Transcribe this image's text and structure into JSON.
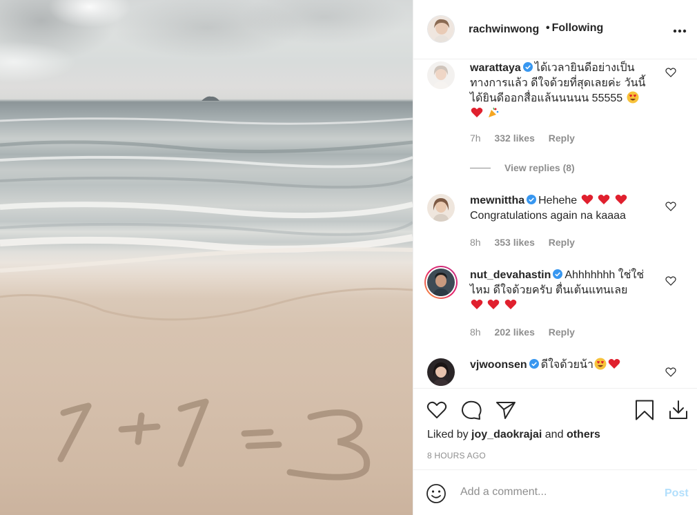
{
  "header": {
    "username": "rachwinwong",
    "follow_label": "Following",
    "more_icon": "more-horizontal-icon"
  },
  "comments": [
    {
      "username": "warattaya",
      "verified": true,
      "text": "ได้เวลายินดีอย่างเป็นทางการแล้ว ดีใจด้วยที่สุดเลยค่ะ วันนี้ได้ยินดีออกสื่อแล้นนนนน 55555",
      "emojis": [
        "heart-eyes-emoji",
        "red-heart-emoji",
        "party-popper-emoji"
      ],
      "time": "7h",
      "likes": "332 likes",
      "reply_label": "Reply",
      "view_replies": "View replies (8)"
    },
    {
      "username": "mewnittha",
      "verified": true,
      "text_a": "Hehehe",
      "text_b": "Congratulations again na kaaaa",
      "emojis": [
        "red-heart-emoji",
        "red-heart-emoji",
        "red-heart-emoji"
      ],
      "time": "8h",
      "likes": "353 likes",
      "reply_label": "Reply"
    },
    {
      "username": "nut_devahastin",
      "verified": true,
      "text": "Ahhhhhhh ใช่ใช่ไหม ดีใจด้วยครับ ตื่นเต้นแทนเลย",
      "emojis": [
        "red-heart-emoji",
        "red-heart-emoji",
        "red-heart-emoji"
      ],
      "time": "8h",
      "likes": "202 likes",
      "reply_label": "Reply"
    },
    {
      "username": "vjwoonsen",
      "verified": true,
      "text": "ดีใจด้วยน้า",
      "emojis": [
        "heart-eyes-emoji",
        "red-heart-emoji"
      ]
    }
  ],
  "actions": {
    "liked_prefix": "Liked by",
    "liked_user": "joy_daokrajai",
    "liked_and": "and",
    "liked_others": "others",
    "time_ago": "8 HOURS AGO"
  },
  "add_comment": {
    "placeholder": "Add a comment...",
    "post_label": "Post"
  },
  "photo": {
    "sand_text": "1+1=3"
  },
  "colors": {
    "verified_blue": "#3897f0",
    "heart_red": "#e0202e",
    "post_disabled": "#b2dffc",
    "meta_gray": "#8e8e8e"
  }
}
